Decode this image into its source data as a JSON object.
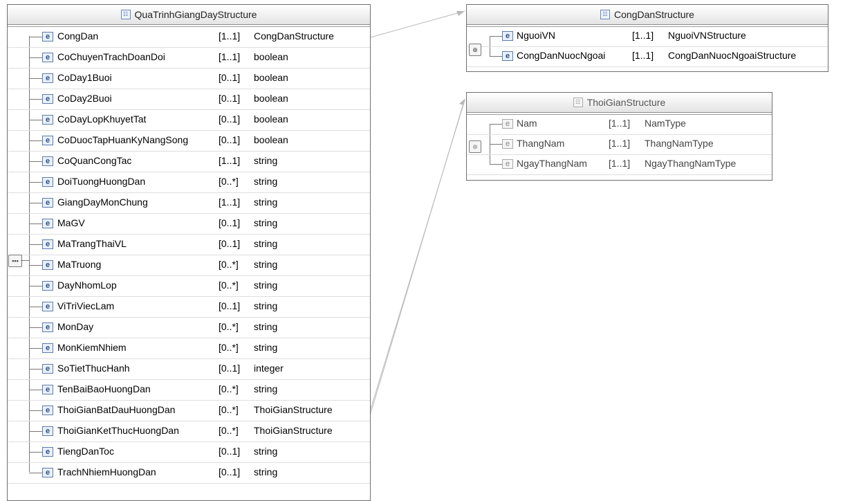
{
  "main": {
    "title": "QuaTrinhGiangDayStructure",
    "compositor_icon": "sequence-compositor-icon",
    "rows": [
      {
        "name": "CongDan",
        "card": "[1..1]",
        "type": "CongDanStructure"
      },
      {
        "name": "CoChuyenTrachDoanDoi",
        "card": "[1..1]",
        "type": "boolean"
      },
      {
        "name": "CoDay1Buoi",
        "card": "[0..1]",
        "type": "boolean"
      },
      {
        "name": "CoDay2Buoi",
        "card": "[0..1]",
        "type": "boolean"
      },
      {
        "name": "CoDayLopKhuyetTat",
        "card": "[0..1]",
        "type": "boolean"
      },
      {
        "name": "CoDuocTapHuanKyNangSong",
        "card": "[0..1]",
        "type": "boolean"
      },
      {
        "name": "CoQuanCongTac",
        "card": "[1..1]",
        "type": "string"
      },
      {
        "name": "DoiTuongHuongDan",
        "card": "[0..*]",
        "type": "string"
      },
      {
        "name": "GiangDayMonChung",
        "card": "[1..1]",
        "type": "string"
      },
      {
        "name": "MaGV",
        "card": "[0..1]",
        "type": "string"
      },
      {
        "name": "MaTrangThaiVL",
        "card": "[0..1]",
        "type": "string"
      },
      {
        "name": "MaTruong",
        "card": "[0..*]",
        "type": "string"
      },
      {
        "name": "DayNhomLop",
        "card": "[0..*]",
        "type": "string"
      },
      {
        "name": "ViTriViecLam",
        "card": "[0..1]",
        "type": "string"
      },
      {
        "name": "MonDay",
        "card": "[0..*]",
        "type": "string"
      },
      {
        "name": "MonKiemNhiem",
        "card": "[0..*]",
        "type": "string"
      },
      {
        "name": "SoTietThucHanh",
        "card": "[0..1]",
        "type": "integer"
      },
      {
        "name": "TenBaiBaoHuongDan",
        "card": "[0..*]",
        "type": "string"
      },
      {
        "name": "ThoiGianBatDauHuongDan",
        "card": "[0..*]",
        "type": "ThoiGianStructure"
      },
      {
        "name": "ThoiGianKetThucHuongDan",
        "card": "[0..*]",
        "type": "ThoiGianStructure"
      },
      {
        "name": "TiengDanToc",
        "card": "[0..1]",
        "type": "string"
      },
      {
        "name": "TrachNhiemHuongDan",
        "card": "[0..1]",
        "type": "string"
      }
    ]
  },
  "congdan": {
    "title": "CongDanStructure",
    "compositor_icon": "choice-compositor-icon",
    "rows": [
      {
        "name": "NguoiVN",
        "card": "[1..1]",
        "type": "NguoiVNStructure"
      },
      {
        "name": "CongDanNuocNgoai",
        "card": "[1..1]",
        "type": "CongDanNuocNgoaiStructure"
      }
    ]
  },
  "thoigian": {
    "title": "ThoiGianStructure",
    "compositor_icon": "choice-compositor-icon",
    "rows": [
      {
        "name": "Nam",
        "card": "[1..1]",
        "type": "NamType"
      },
      {
        "name": "ThangNam",
        "card": "[1..1]",
        "type": "ThangNamType"
      },
      {
        "name": "NgayThangNam",
        "card": "[1..1]",
        "type": "NgayThangNamType"
      }
    ]
  },
  "element_icon_letter": "e",
  "type_icon_letter": "☷"
}
